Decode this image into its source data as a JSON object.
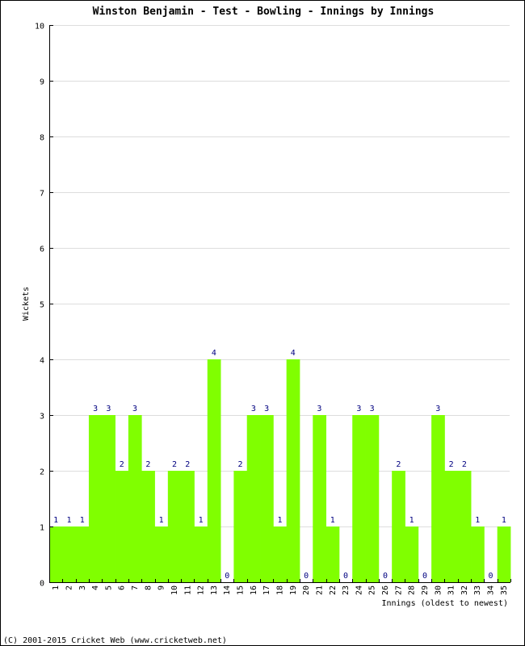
{
  "chart_data": {
    "type": "bar",
    "title": "Winston Benjamin - Test - Bowling - Innings by Innings",
    "xlabel": "Innings (oldest to newest)",
    "ylabel": "Wickets",
    "ylim": [
      0,
      10
    ],
    "yticks": [
      0,
      1,
      2,
      3,
      4,
      5,
      6,
      7,
      8,
      9,
      10
    ],
    "grid": true,
    "bar_color": "#80ff00",
    "label_color": "#000080",
    "categories": [
      "1",
      "2",
      "3",
      "4",
      "5",
      "6",
      "7",
      "8",
      "9",
      "10",
      "11",
      "12",
      "13",
      "14",
      "15",
      "16",
      "17",
      "18",
      "19",
      "20",
      "21",
      "22",
      "23",
      "24",
      "25",
      "26",
      "27",
      "28",
      "29",
      "30",
      "31",
      "32",
      "33",
      "34",
      "35"
    ],
    "values": [
      1,
      1,
      1,
      3,
      3,
      2,
      3,
      2,
      1,
      2,
      2,
      1,
      4,
      0,
      2,
      3,
      3,
      1,
      4,
      0,
      3,
      1,
      0,
      3,
      3,
      0,
      2,
      1,
      0,
      3,
      2,
      2,
      1,
      0,
      1
    ]
  },
  "footer": "(C) 2001-2015 Cricket Web (www.cricketweb.net)"
}
